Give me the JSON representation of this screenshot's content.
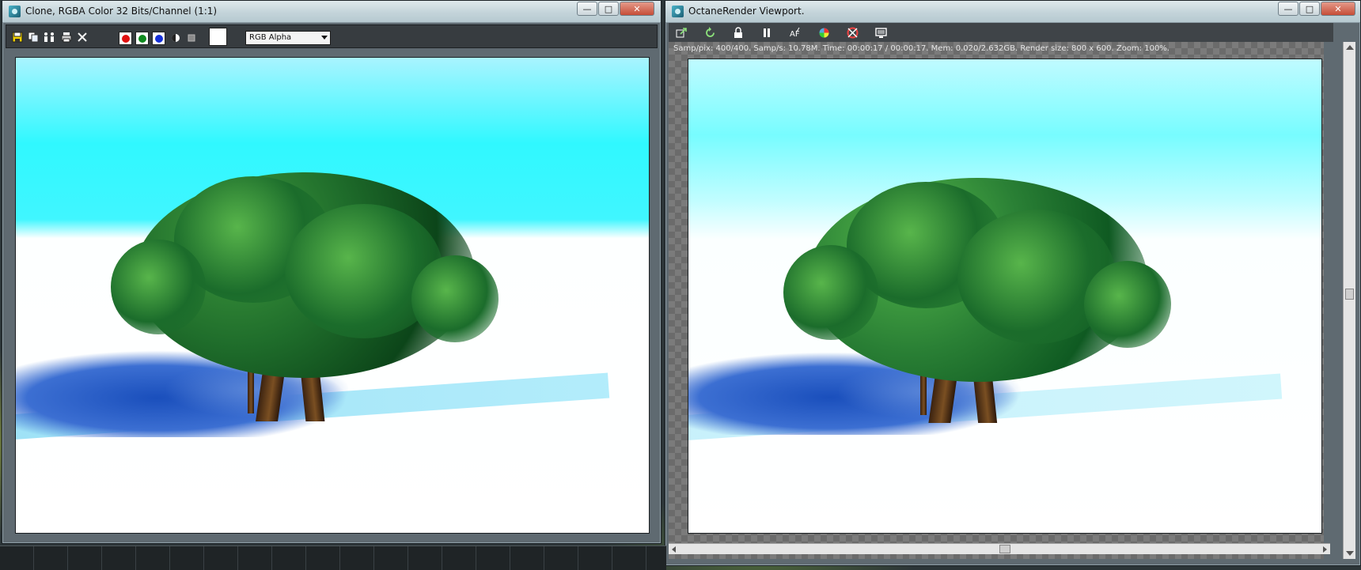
{
  "left_window": {
    "title": "Clone, RGBA Color 32 Bits/Channel (1:1)",
    "toolbar": {
      "icons": [
        "save-icon",
        "copy-icon",
        "clone-icon",
        "print-icon",
        "clear-icon"
      ],
      "channels": [
        {
          "name": "red-channel",
          "color": "#e01010"
        },
        {
          "name": "green-channel",
          "color": "#0f8a1f"
        },
        {
          "name": "blue-channel",
          "color": "#1530d8"
        }
      ],
      "channel_select": "RGB Alpha"
    }
  },
  "right_window": {
    "title": "OctaneRender Viewport.",
    "toolbar_icons": [
      "export-icon",
      "refresh-icon",
      "lock-icon",
      "pause-icon",
      "autofocus-icon",
      "color-picker-icon",
      "region-render-icon",
      "display-icon"
    ],
    "status": "Samp/pix: 400/400.   Samp/s: 10.78M.   Time: 00:00:17 / 00:00:17.   Mem: 0.020/2.632GB.   Render size: 800 x 600.   Zoom: 100%."
  },
  "window_controls": {
    "minimize": "—",
    "maximize": "□",
    "close": "✕"
  },
  "colors": {
    "sky": "#30f8ff",
    "foliage": "#1f6d2b",
    "shadow": "#1a4fbc"
  }
}
